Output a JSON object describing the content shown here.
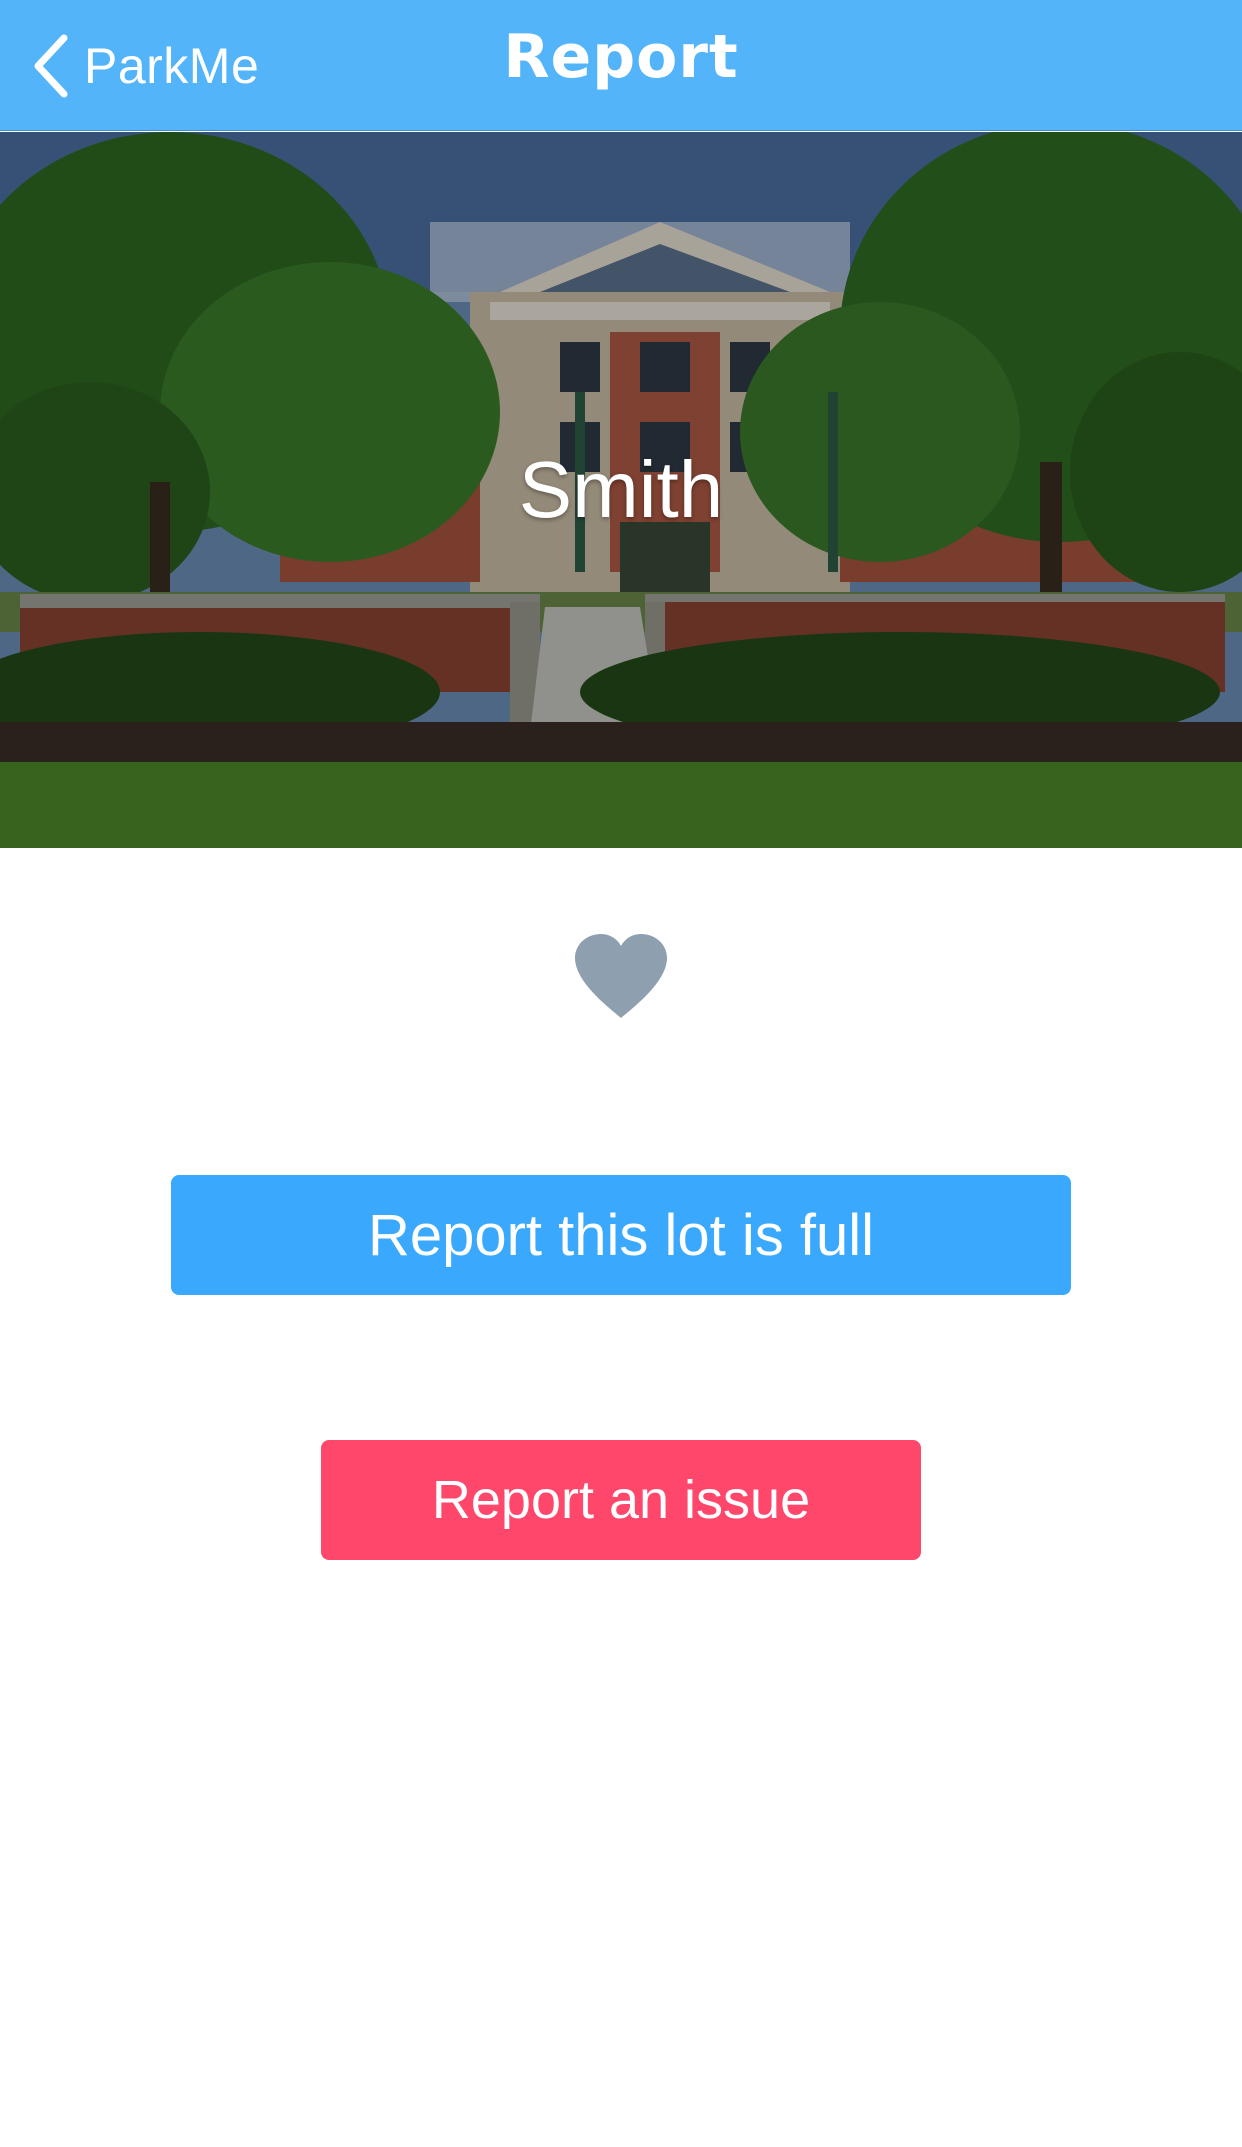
{
  "navbar": {
    "back_label": "ParkMe",
    "title": "Report",
    "background_color": "#54b4fa",
    "back_icon": "chevron-left-icon"
  },
  "lot": {
    "name": "Smith",
    "image_description": "Brick building with trees and walkway",
    "favorite_icon": "heart-icon",
    "favorite_color": "#8e9faf"
  },
  "actions": {
    "report_full_label": "Report this lot is full",
    "report_full_color": "#3aa9fd",
    "report_issue_label": "Report an issue",
    "report_issue_color": "#fe476b"
  }
}
